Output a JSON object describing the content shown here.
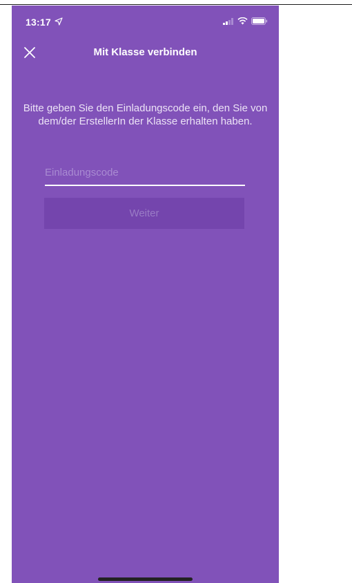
{
  "status_bar": {
    "time": "13:17",
    "icons": [
      "location-arrow-icon",
      "signal-icon",
      "wifi-icon",
      "battery-icon"
    ]
  },
  "nav": {
    "close_icon": "close-icon",
    "title": "Mit Klasse verbinden"
  },
  "main": {
    "instructions": "Bitte geben Sie den Einladungscode ein, den Sie von dem/der ErstellerIn der Klasse erhalten haben.",
    "invite_code": {
      "value": "",
      "placeholder": "Einladungscode"
    },
    "continue_label": "Weiter"
  },
  "colors": {
    "background": "#8152b9",
    "button_disabled": "#7445ad",
    "text": "#ffffff"
  }
}
